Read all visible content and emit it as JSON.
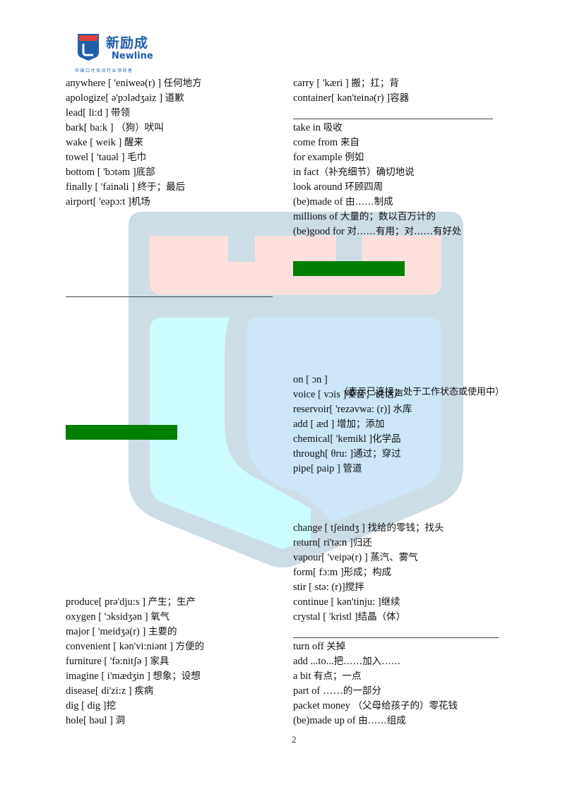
{
  "logo": {
    "name_cn": "新励成",
    "name_en": "Newline",
    "tagline": "中国口才培训行业领导者"
  },
  "colors": {
    "brand_blue": "#1f5fa8",
    "logo_red": "#e0443a",
    "green_bar": "#027f02",
    "watermark_frame": "#cddde6",
    "watermark_pink": "#fde0dc",
    "watermark_cyan": "#ccfcff",
    "watermark_blue": "#cce6f8"
  },
  "left_column": {
    "group1": [
      {
        "en": "anywhere [ 'eniweə(r) ] ",
        "cn": "任何地方"
      },
      {
        "en": "apologize[ ə'pɔlədʒaiz ] ",
        "cn": "道歉"
      },
      {
        "en": "lead[ li:d ] ",
        "cn": "带领"
      },
      {
        "en": "bark[ ba:k ] ",
        "cn": "（狗）吠叫"
      },
      {
        "en": "wake [ weik ] ",
        "cn": "醒来"
      },
      {
        "en": "towel [ 'tauəl ] ",
        "cn": "毛巾"
      },
      {
        "en": "bottom [ 'bɔtəm ]",
        "cn": "底部"
      },
      {
        "en": "finally [ 'fainəli ] ",
        "cn": "终于；最后"
      },
      {
        "en": "airport[ 'eəpɔ:t ]",
        "cn": "机场"
      }
    ],
    "group2": [
      {
        "en": "produce[ prə'dju:s ] ",
        "cn": "产生；生产"
      },
      {
        "en": "oxygen [ 'ɔksidʒən ] ",
        "cn": "氧气"
      },
      {
        "en": "major [ 'meidʒə(r) ] ",
        "cn": "主要的"
      },
      {
        "en": "convenient [ kən'vi:niənt ] ",
        "cn": "方便的"
      },
      {
        "en": "furniture [ 'fə:nitʃə ] ",
        "cn": "家具"
      },
      {
        "en": "imagine [ i'mædʒin ] ",
        "cn": "想象；设想"
      },
      {
        "en": "disease[ di'zi:z ] ",
        "cn": "疾病"
      },
      {
        "en": "dig [ dig ]",
        "cn": "挖"
      },
      {
        "en": "hole[ həul ] ",
        "cn": "洞"
      }
    ]
  },
  "right_column": {
    "group1": [
      {
        "en": "carry [ 'kæri ] ",
        "cn": "搬；扛；背"
      },
      {
        "en": "container[ kən'teinə(r) ]",
        "cn": "容器"
      }
    ],
    "group2": [
      {
        "en": "take in ",
        "cn": "吸收"
      },
      {
        "en": "come from ",
        "cn": "来自"
      },
      {
        "en": "for example ",
        "cn": "例如"
      },
      {
        "en": "in fact",
        "cn": "（补充细节）确切地说"
      },
      {
        "en": "look around ",
        "cn": "环顾四周"
      },
      {
        "en": "(be)made of ",
        "cn": "由……制成"
      },
      {
        "en": "millions of ",
        "cn": "大量的；数以百万计的"
      },
      {
        "en": "(be)good    for ",
        "cn": "对……有用；对……有好处"
      }
    ],
    "group3": [
      {
        "en": "on [ ɔn ]",
        "cn": ""
      },
      {
        "en": "voice [ vɔis ]",
        "cn": "嗓音；说话声"
      },
      {
        "en": "reservoir[ 'rezəvwa: (r)] ",
        "cn": "水库"
      },
      {
        "en": "add [ æd ] ",
        "cn": "增加；添加"
      },
      {
        "en": "chemical[ 'kemikl ]",
        "cn": "化学品"
      },
      {
        "en": "through[ θru: ]",
        "cn": "通过；穿过"
      },
      {
        "en": "pipe[ paip ] ",
        "cn": "管道"
      }
    ],
    "on_meaning_overlay": "（表示已连接；处于工作状态或使用中）",
    "group4": [
      {
        "en": "change [ tʃeindʒ ] ",
        "cn": "找给的零钱；找头"
      },
      {
        "en": "return[ ri'tə:n ]",
        "cn": "归还"
      },
      {
        "en": "vapour[ 'veipə(r) ] ",
        "cn": "蒸汽、雾气"
      },
      {
        "en": "form[ fɔ:m ]",
        "cn": "形成；构成"
      },
      {
        "en": "stir [ stə: (r)]",
        "cn": "搅拌"
      },
      {
        "en": "continue [ kən'tinju: ]",
        "cn": "继续"
      },
      {
        "en": "crystal [ 'kristl ]",
        "cn": "结晶（体）"
      }
    ],
    "group5": [
      {
        "en": "turn off ",
        "cn": "关掉"
      },
      {
        "en": "add ...to...",
        "cn": "把……加入……"
      },
      {
        "en": "a bit ",
        "cn": "有点；一点"
      },
      {
        "en": "part    of ……",
        "cn": "的一部分"
      },
      {
        "en": "packet money ",
        "cn": "（父母给孩子的）零花钱"
      },
      {
        "en": "(be)made up of ",
        "cn": "由……组成"
      }
    ]
  },
  "page_number": "2"
}
